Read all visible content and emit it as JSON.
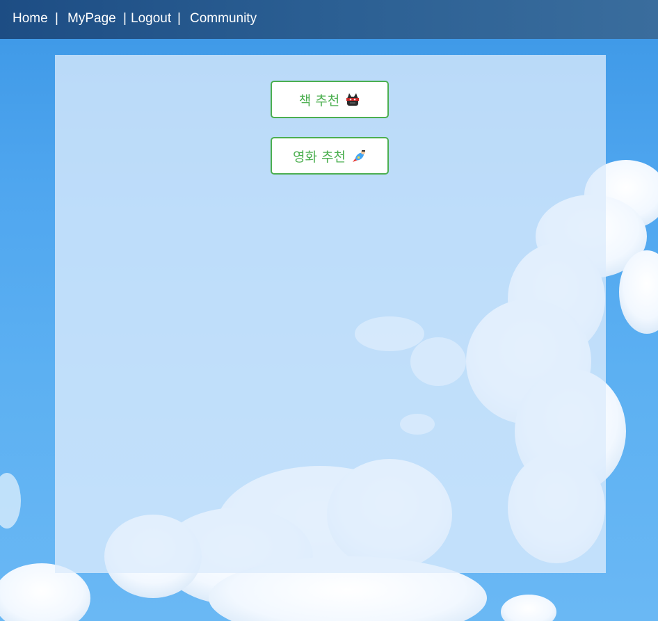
{
  "nav": {
    "home": "Home",
    "sep1": "|",
    "mypage": "MyPage",
    "sep2": "|",
    "logout": "Logout",
    "sep3": "|",
    "community": "Community"
  },
  "buttons": {
    "book": {
      "label": "책 추천",
      "icon": "ninja-cat-icon"
    },
    "movie": {
      "label": "영화 추천",
      "icon": "superhero-icon"
    }
  },
  "colors": {
    "nav_bg": "#1d4d84",
    "button_border": "#4caf50",
    "button_text": "#4caf50",
    "sky": "#4fa6ef"
  }
}
